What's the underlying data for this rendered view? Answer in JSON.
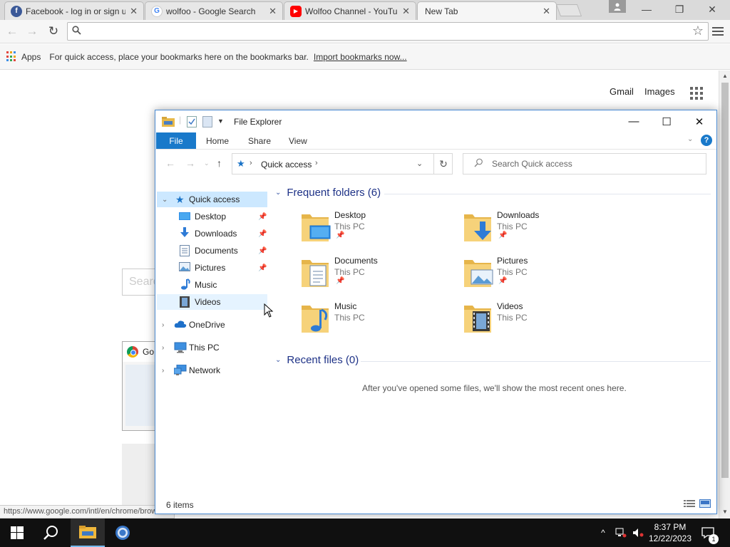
{
  "browser": {
    "tabs": [
      {
        "title": "Facebook - log in or sign up",
        "favicon": "facebook-icon",
        "color": "#3b5998"
      },
      {
        "title": "wolfoo - Google Search",
        "favicon": "google-icon",
        "color": "#4285f4"
      },
      {
        "title": "Wolfoo Channel - YouTube",
        "favicon": "youtube-icon",
        "color": "#ff0000"
      },
      {
        "title": "New Tab",
        "favicon": "",
        "color": ""
      }
    ],
    "omnibox": {
      "value": "",
      "placeholder": ""
    },
    "bookmarks_bar": {
      "apps_label": "Apps",
      "hint": "For quick access, place your bookmarks here on the bookmarks bar.",
      "import_link": "Import bookmarks now..."
    },
    "page": {
      "gmail": "Gmail",
      "images": "Images",
      "search_placeholder": "Search",
      "thumb_title": "Go"
    },
    "status_url": "https://www.google.com/intl/en/chrome/browser/"
  },
  "explorer": {
    "title": "File Explorer",
    "ribbon_tabs": [
      "File",
      "Home",
      "Share",
      "View"
    ],
    "address": {
      "crumb": "Quick access"
    },
    "search_placeholder": "Search Quick access",
    "nav": {
      "quick_access": "Quick access",
      "pinned": [
        {
          "label": "Desktop",
          "icon": "desktop-icon",
          "pinned": true
        },
        {
          "label": "Downloads",
          "icon": "download-icon",
          "pinned": true
        },
        {
          "label": "Documents",
          "icon": "document-icon",
          "pinned": true
        },
        {
          "label": "Pictures",
          "icon": "pictures-icon",
          "pinned": true
        },
        {
          "label": "Music",
          "icon": "music-icon",
          "pinned": false
        },
        {
          "label": "Videos",
          "icon": "video-icon",
          "pinned": false
        }
      ],
      "onedrive": "OneDrive",
      "this_pc": "This PC",
      "network": "Network"
    },
    "frequent_header": "Frequent folders (6)",
    "folders": [
      {
        "name": "Desktop",
        "location": "This PC",
        "pinned": true,
        "overlay": "desktop-icon"
      },
      {
        "name": "Downloads",
        "location": "This PC",
        "pinned": true,
        "overlay": "download-icon"
      },
      {
        "name": "Documents",
        "location": "This PC",
        "pinned": true,
        "overlay": "document-icon"
      },
      {
        "name": "Pictures",
        "location": "This PC",
        "pinned": true,
        "overlay": "pictures-icon"
      },
      {
        "name": "Music",
        "location": "This PC",
        "pinned": false,
        "overlay": "music-icon"
      },
      {
        "name": "Videos",
        "location": "This PC",
        "pinned": false,
        "overlay": "video-icon"
      }
    ],
    "recent_header": "Recent files (0)",
    "recent_empty": "After you've opened some files, we'll show the most recent ones here.",
    "status_count": "6 items"
  },
  "taskbar": {
    "time": "8:37 PM",
    "date": "12/22/2023",
    "notification_count": "1"
  },
  "colors": {
    "accent": "#1979ca",
    "selection": "#cce8ff",
    "folder": "#f3c95a",
    "taskbar": "#101010"
  }
}
